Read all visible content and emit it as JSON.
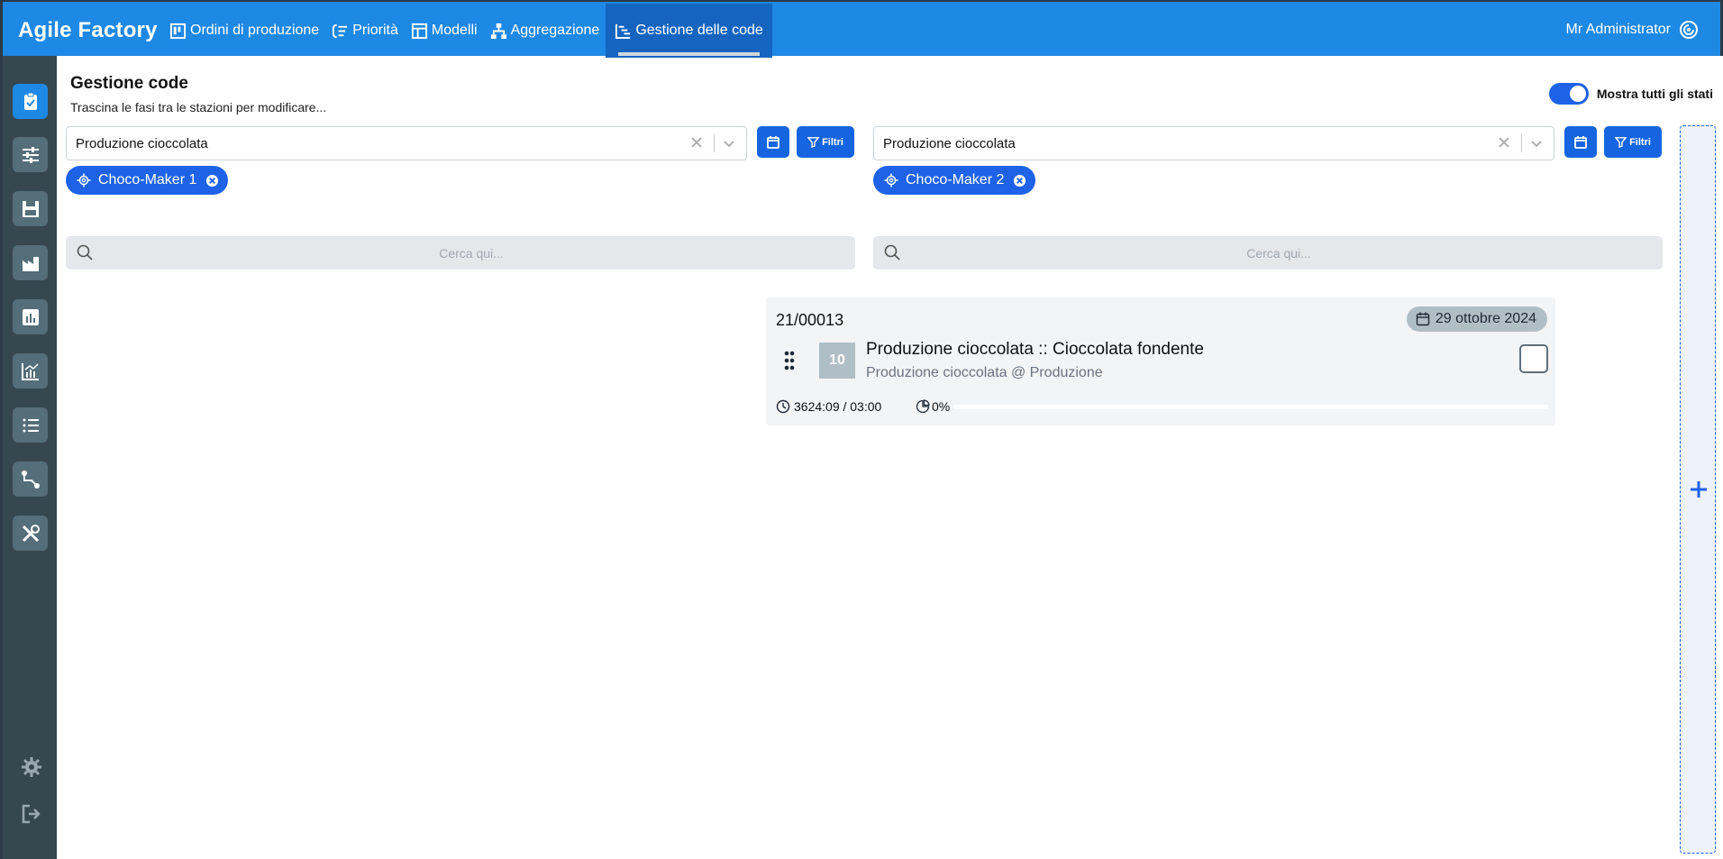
{
  "app": {
    "brand": "Agile Factory",
    "user": "Mr Administrator",
    "accent": "#1e88e5",
    "primary": "#1e62e8",
    "sidebar_bg": "#37474f"
  },
  "nav": [
    {
      "label": "Ordini di produzione",
      "icon": "kanban-icon"
    },
    {
      "label": "Priorità",
      "icon": "priority-icon"
    },
    {
      "label": "Modelli",
      "icon": "template-icon"
    },
    {
      "label": "Aggregazione",
      "icon": "hierarchy-icon"
    },
    {
      "label": "Gestione delle code",
      "icon": "queue-icon",
      "active": true
    }
  ],
  "sidebar": [
    {
      "icon": "clipboard-check-icon",
      "active": true
    },
    {
      "icon": "sliders-icon"
    },
    {
      "icon": "floppy-icon"
    },
    {
      "icon": "factory-icon"
    },
    {
      "icon": "bar-chart-icon"
    },
    {
      "icon": "line-chart-icon"
    },
    {
      "icon": "list-icon"
    },
    {
      "icon": "route-icon"
    },
    {
      "icon": "tools-icon"
    },
    {
      "icon": "gear-icon"
    },
    {
      "icon": "logout-icon"
    }
  ],
  "page": {
    "title": "Gestione code",
    "subtitle": "Trascina le fasi tra le stazioni per modificare...",
    "toggle_label": "Mostra tutti gli stati",
    "toggle_on": true
  },
  "columns": [
    {
      "select_value": "Produzione cioccolata",
      "filter_label": "Filtri",
      "station": "Choco-Maker 1",
      "search_placeholder": "Cerca qui..."
    },
    {
      "select_value": "Produzione cioccolata",
      "filter_label": "Filtri",
      "station": "Choco-Maker 2",
      "search_placeholder": "Cerca qui..."
    }
  ],
  "card": {
    "code": "21/00013",
    "date": "29 ottobre 2024",
    "sequence": "10",
    "title": "Produzione cioccolata :: Cioccolata fondente",
    "subtitle": "Produzione cioccolata @ Produzione",
    "time": "3624:09 / 03:00",
    "progress_label": "0%",
    "progress_value": 0
  }
}
